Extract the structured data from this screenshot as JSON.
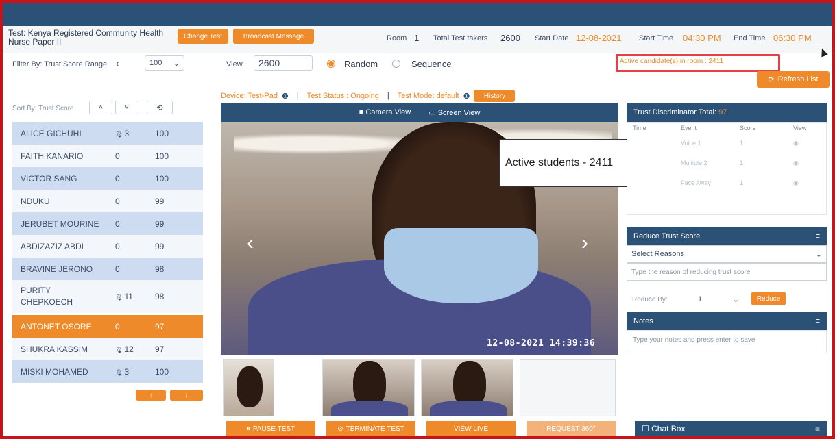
{
  "header": {
    "test_title": "Test: Kenya Registered Community Health Nurse Paper II",
    "change_test": "Change Test",
    "broadcast": "Broadcast Message",
    "room_label": "Room",
    "room_value": "1",
    "takers_label": "Total Test takers",
    "takers_value": "2600",
    "start_date_label": "Start Date",
    "start_date_value": "12-08-2021",
    "start_time_label": "Start Time",
    "start_time_value": "04:30 PM",
    "end_time_label": "End Time",
    "end_time_value": "06:30 PM"
  },
  "filter": {
    "label": "Filter By: Trust Score Range",
    "range_value": "100",
    "view_label": "View",
    "view_value": "2600",
    "random": "Random",
    "sequence": "Sequence"
  },
  "active": {
    "text": "Active candidate(s) in room : 2411",
    "refresh": "Refresh List"
  },
  "device_line": {
    "device": "Device: Test-Pad",
    "status": "Test Status : Ongoing",
    "mode": "Test Mode: default",
    "history": "History"
  },
  "sort": {
    "label": "Sort By: Trust Score"
  },
  "candidates": [
    {
      "name": "ALICE GICHUHI",
      "flags": "3",
      "mic": true,
      "score": "100"
    },
    {
      "name": "FAITH KANARIO",
      "flags": "0",
      "mic": false,
      "score": "100"
    },
    {
      "name": "VICTOR SANG",
      "flags": "0",
      "mic": false,
      "score": "100"
    },
    {
      "name": "NDUKU",
      "flags": "0",
      "mic": false,
      "score": "99"
    },
    {
      "name": "JERUBET MOURINE",
      "flags": "0",
      "mic": false,
      "score": "99"
    },
    {
      "name": "ABDIZAZIZ ABDI",
      "flags": "0",
      "mic": false,
      "score": "99"
    },
    {
      "name": "BRAVINE JERONO",
      "flags": "0",
      "mic": false,
      "score": "98"
    },
    {
      "name": "PURITY CHEPKOECH",
      "flags": "11",
      "mic": true,
      "score": "98"
    },
    {
      "name": "ANTONET OSORE",
      "flags": "0",
      "mic": false,
      "score": "97"
    },
    {
      "name": "SHUKRA KASSIM",
      "flags": "12",
      "mic": true,
      "score": "97"
    },
    {
      "name": "MISKI MOHAMED",
      "flags": "3",
      "mic": true,
      "score": "100"
    }
  ],
  "video": {
    "camera_view": "Camera View",
    "screen_view": "Screen View",
    "timestamp": "12-08-2021 14:39:36"
  },
  "callout": {
    "text": "Active students - 2411"
  },
  "trust": {
    "title": "Trust Discriminator Total:",
    "total": "97",
    "cols": [
      "Time",
      "Event",
      "Score",
      "View"
    ],
    "rows": [
      {
        "event": "Voice 1",
        "score": "1"
      },
      {
        "event": "Multiple 2",
        "score": "1"
      },
      {
        "event": "Face Away",
        "score": "1"
      }
    ]
  },
  "reduce": {
    "title": "Reduce Trust Score",
    "select": "Select Reasons",
    "reason_placeholder": "Type the reason of reducing trust score",
    "by_label": "Reduce By:",
    "by_value": "1",
    "button": "Reduce"
  },
  "notes": {
    "title": "Notes",
    "placeholder": "Type your notes and press enter to save"
  },
  "actions": {
    "pause": "Pause Test",
    "terminate": "Terminate Test",
    "view_live": "View Live",
    "request": "Request 360°"
  },
  "chat": {
    "title": "Chat Box"
  },
  "colors": {
    "navy": "#2b5177",
    "orange": "#ef8a2a",
    "red": "#c8131b",
    "row_blue": "#cddcf0"
  }
}
